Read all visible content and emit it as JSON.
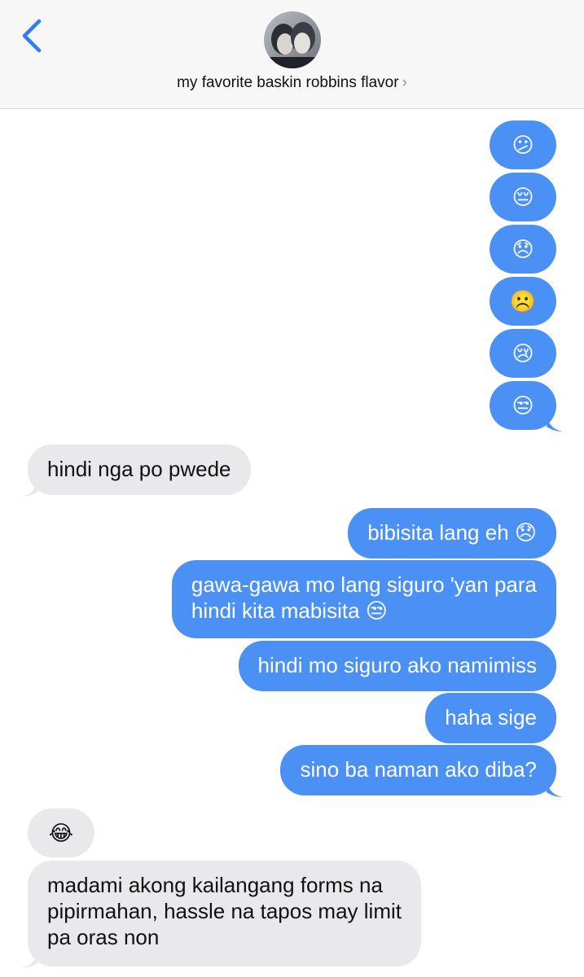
{
  "header": {
    "contact_name": "my favorite baskin robbins flavor",
    "chevron": "›",
    "back_icon": "chevron-left-icon",
    "accent": "#2f7df6"
  },
  "colors": {
    "outgoing_bubble": "#4a90f5",
    "incoming_bubble": "#e9e9eb"
  },
  "messages": [
    {
      "from": "me",
      "text": "😕"
    },
    {
      "from": "me",
      "text": "😔"
    },
    {
      "from": "me",
      "text": "😞"
    },
    {
      "from": "me",
      "text": "☹️"
    },
    {
      "from": "me",
      "text": "😢"
    },
    {
      "from": "me",
      "text": "😒"
    },
    {
      "from": "them",
      "text": "hindi nga po pwede"
    },
    {
      "from": "me",
      "text": "bibisita lang eh 😞"
    },
    {
      "from": "me",
      "lines": [
        "gawa-gawa mo lang siguro 'yan para",
        "hindi kita mabisita 😒"
      ]
    },
    {
      "from": "me",
      "text": "hindi mo siguro ako namimiss"
    },
    {
      "from": "me",
      "text": "haha sige"
    },
    {
      "from": "me",
      "text": "sino ba naman ako diba?"
    },
    {
      "from": "them",
      "text": "😂"
    },
    {
      "from": "them",
      "lines": [
        "madami akong kailangang forms na",
        "pipirmahan, hassle na tapos may limit",
        "pa oras non"
      ]
    }
  ]
}
